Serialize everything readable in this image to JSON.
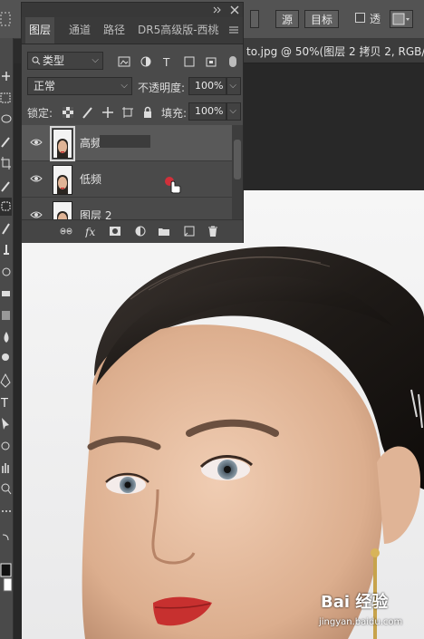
{
  "options_bar": {
    "source_button": "源",
    "target_button": "目标",
    "transparent_label": "透"
  },
  "document_tab": {
    "title": "to.jpg @ 50%(图层 2 拷贝 2, RGB/..."
  },
  "layers_panel": {
    "tabs": [
      "图层",
      "通道",
      "路径",
      "DR5高级版-西桃"
    ],
    "filter_kind": "类型",
    "blend_mode": "正常",
    "opacity_label": "不透明度:",
    "opacity_value": "100%",
    "lock_label": "锁定:",
    "fill_label": "填充:",
    "fill_value": "100%",
    "layers": [
      {
        "name": "高频",
        "visible": true,
        "selected": true
      },
      {
        "name": "低频",
        "visible": true,
        "selected": false
      },
      {
        "name": "图层 2",
        "visible": true,
        "selected": false
      }
    ],
    "bottom_icons": [
      "link-icon",
      "fx-icon",
      "mask-icon",
      "adjustment-icon",
      "folder-icon",
      "new-layer-icon",
      "trash-icon"
    ]
  },
  "watermark": {
    "brand": "Bai  经验",
    "url": "jingyan.baidu.com"
  },
  "colors": {
    "panel_bg": "#4a4a4a",
    "selected_layer": "#595959",
    "lips": "#c7302f",
    "hair": "#2a2520"
  }
}
